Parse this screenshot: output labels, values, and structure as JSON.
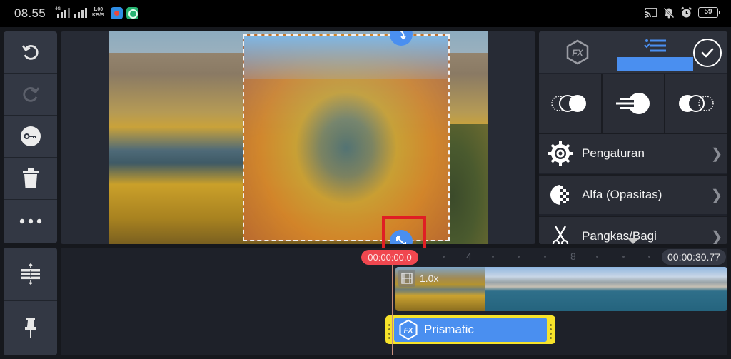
{
  "status_bar": {
    "time": "08.55",
    "network_type": "4G",
    "data_speed_value": "1.00",
    "data_speed_unit": "KB/S",
    "battery_level": "59",
    "left_icons": [
      "screen-recorder-icon",
      "whatsapp-icon"
    ],
    "right_icons": [
      "cast-icon",
      "notifications-off-icon",
      "alarm-icon",
      "battery-icon"
    ]
  },
  "left_toolbar": {
    "top_tools": [
      {
        "name": "undo",
        "icon": "undo-icon",
        "enabled": true
      },
      {
        "name": "redo",
        "icon": "redo-icon",
        "enabled": false
      },
      {
        "name": "keyframe",
        "icon": "key-icon",
        "enabled": true
      },
      {
        "name": "delete",
        "icon": "trash-icon",
        "enabled": true
      },
      {
        "name": "more",
        "icon": "more-icon",
        "enabled": true
      }
    ],
    "bottom_tools": [
      {
        "name": "timeline-zoom",
        "icon": "expand-tracks-icon"
      },
      {
        "name": "pin",
        "icon": "pin-icon"
      }
    ]
  },
  "right_panel": {
    "tabs": [
      {
        "name": "effects",
        "icon": "fx-hexagon-icon",
        "active": false
      },
      {
        "name": "options",
        "icon": "checklist-icon",
        "active": true
      }
    ],
    "done_icon": "checkmark-circle-icon",
    "animations": [
      {
        "name": "in-animation",
        "icon": "in-animation-icon"
      },
      {
        "name": "out-animation",
        "icon": "motion-animation-icon"
      },
      {
        "name": "overall-animation",
        "icon": "out-animation-icon"
      }
    ],
    "menu_items": [
      {
        "label": "Pengaturan",
        "icon": "settings-gear-icon"
      },
      {
        "label": "Alfa (Opasitas)",
        "icon": "alpha-opacity-icon"
      },
      {
        "label": "Pangkas/Bagi",
        "icon": "scissors-icon"
      }
    ]
  },
  "timeline": {
    "playhead_time": "00:00:00.0",
    "total_duration": "00:00:30.77",
    "ruler_labels": [
      "4",
      "8"
    ],
    "video_clip_speed": "1.0x",
    "effect_clip": {
      "label": "Prismatic",
      "icon": "fx-hexagon-icon"
    }
  },
  "colors": {
    "accent_blue": "#4a8ff0",
    "playhead_red": "#f0474f",
    "selection_yellow": "#f7e32a",
    "highlight_red": "#e01e24"
  }
}
